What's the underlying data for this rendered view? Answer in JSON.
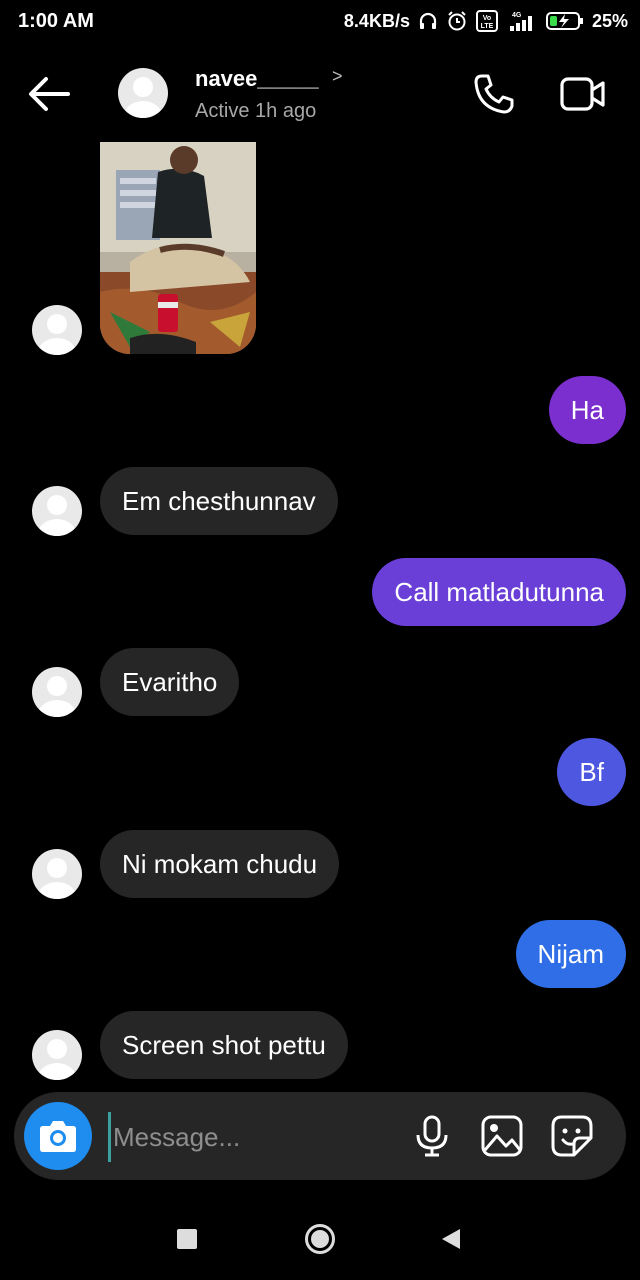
{
  "status_bar": {
    "time": "1:00 AM",
    "speed": "8.4KB/s",
    "network_4g": "4G",
    "volte": "Vo LTE",
    "battery": "25%"
  },
  "header": {
    "name": "navee_____",
    "chevron": ">",
    "status": "Active 1h ago"
  },
  "messages": [
    {
      "direction": "in",
      "text": "Em chesthunnav"
    },
    {
      "direction": "out",
      "text": "Ha",
      "color": "#7a2fce"
    },
    {
      "direction": "out",
      "text": "Call matladutunna",
      "color": "#6a3fd8"
    },
    {
      "direction": "in",
      "text": "Evaritho"
    },
    {
      "direction": "out",
      "text": "Bf",
      "color": "#4d57e0"
    },
    {
      "direction": "in",
      "text": "Ni mokam chudu"
    },
    {
      "direction": "out",
      "text": "Nijam",
      "color": "#2f6ee6"
    },
    {
      "direction": "in",
      "text": "Screen shot pettu"
    }
  ],
  "composer": {
    "placeholder": "Message..."
  },
  "colors": {
    "incoming_bubble": "#262626",
    "camera_button": "#1f8cf0"
  }
}
